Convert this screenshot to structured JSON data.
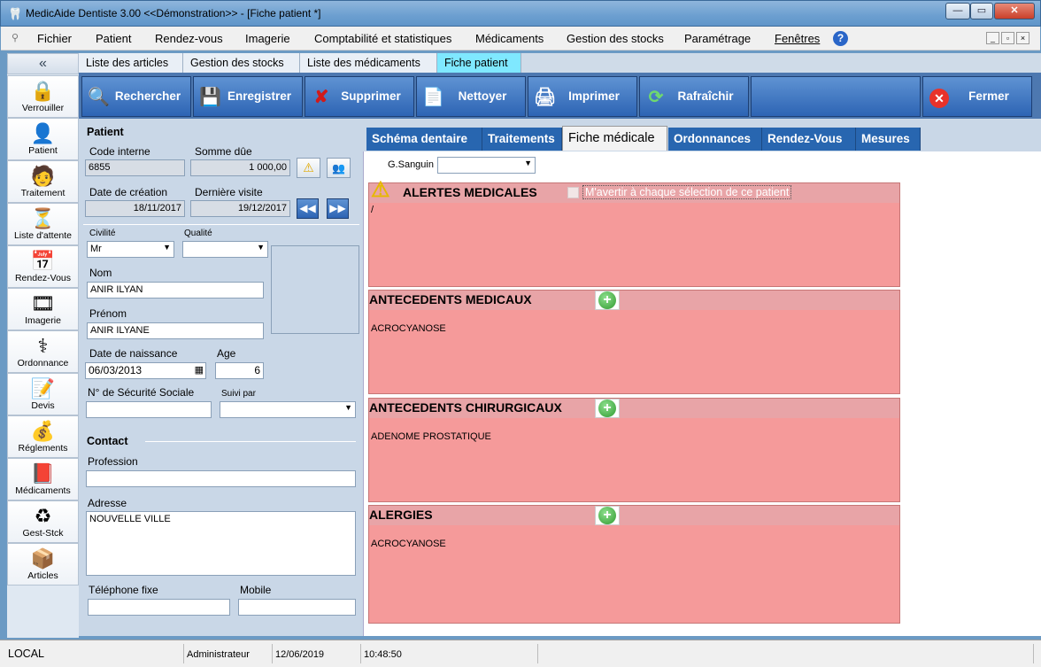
{
  "window": {
    "title": "MedicAide Dentiste 3.00 <<Démonstration>>  - [Fiche patient *]"
  },
  "menu": [
    "Fichier",
    "Patient",
    "Rendez-vous",
    "Imagerie",
    "Comptabilité et statistiques",
    "Médicaments",
    "Gestion des stocks",
    "Paramétrage",
    "Fenêtres"
  ],
  "sidebar": {
    "collapse": "«",
    "items": [
      {
        "label": "Verrouiller",
        "icon": "🔒"
      },
      {
        "label": "Patient",
        "icon": "👤"
      },
      {
        "label": "Traitement",
        "icon": "🧑"
      },
      {
        "label": "Liste d'attente",
        "icon": "⏳"
      },
      {
        "label": "Rendez-Vous",
        "icon": "📅"
      },
      {
        "label": "Imagerie",
        "icon": "🎞"
      },
      {
        "label": "Ordonnance",
        "icon": "⚕"
      },
      {
        "label": "Devis",
        "icon": "📝"
      },
      {
        "label": "Réglements",
        "icon": "💰"
      },
      {
        "label": "Médicaments",
        "icon": "📕"
      },
      {
        "label": "Gest-Stck",
        "icon": "♻"
      },
      {
        "label": "Articles",
        "icon": "📦"
      }
    ]
  },
  "top_tabs": [
    "Liste des articles",
    "Gestion des stocks",
    "Liste des médicaments",
    "Fiche patient"
  ],
  "toolbar": {
    "search": "Rechercher",
    "save": "Enregistrer",
    "delete": "Supprimer",
    "clear": "Nettoyer",
    "print": "Imprimer",
    "refresh": "Rafraîchir",
    "close": "Fermer"
  },
  "patient": {
    "section_title": "Patient",
    "code_label": "Code interne",
    "code_value": "6855",
    "due_label": "Somme dûe",
    "due_value": "1 000,00",
    "created_label": "Date de création",
    "created_value": "18/11/2017",
    "lastvisit_label": "Dernière visite",
    "lastvisit_value": "19/12/2017",
    "civility_label": "Civilité",
    "civility_value": "Mr",
    "quality_label": "Qualité",
    "quality_value": "",
    "name_label": "Nom",
    "name_value": "ANIR ILYAN",
    "firstname_label": "Prénom",
    "firstname_value": "ANIR ILYANE",
    "dob_label": "Date de naissance",
    "dob_value": "06/03/2013",
    "age_label": "Age",
    "age_value": "6",
    "ssn_label": "N° de Sécurité Sociale",
    "ssn_value": "",
    "followed_label": "Suivi par",
    "followed_value": ""
  },
  "contact": {
    "section_title": "Contact",
    "profession_label": "Profession",
    "profession_value": "",
    "address_label": "Adresse",
    "address_value": "NOUVELLE VILLE",
    "phone_label": "Téléphone fixe",
    "phone_value": "",
    "mobile_label": "Mobile",
    "mobile_value": ""
  },
  "medical_tabs": [
    "Schéma dentaire",
    "Traitements",
    "Fiche médicale",
    "Ordonnances",
    "Rendez-Vous",
    "Mesures"
  ],
  "medical": {
    "blood_label": "G.Sanguin",
    "blood_value": "",
    "alerts_title": "ALERTES MEDICALES",
    "alerts_check_label": "M'avertir à chaque sélection de ce patient",
    "alerts_text": "/",
    "antecedents_med_title": "ANTECEDENTS MEDICAUX",
    "antecedents_med_text": "ACROCYANOSE",
    "antecedents_chir_title": "ANTECEDENTS CHIRURGICAUX",
    "antecedents_chir_text": "ADENOME PROSTATIQUE",
    "allergies_title": "ALERGIES",
    "allergies_text": "ACROCYANOSE"
  },
  "status": {
    "location": "LOCAL",
    "user": "Administrateur",
    "date": "12/06/2019",
    "time": "10:48:50"
  }
}
